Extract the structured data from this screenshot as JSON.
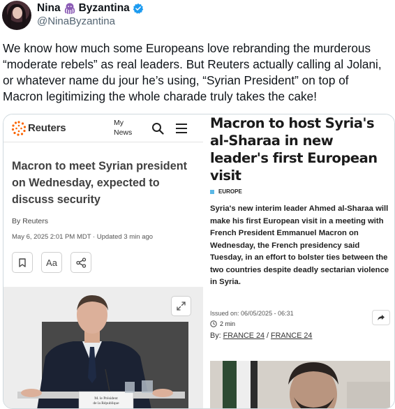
{
  "author": {
    "display_name": "Nina",
    "display_name_suffix": "Byzantina",
    "handle": "@NinaByzantina",
    "badge": "verified-icon",
    "emoji": "octopus-icon"
  },
  "tweet": {
    "text": "We know how much some Europeans love rebranding the murderous “moderate rebels” as real leaders. But Reuters actually calling al Jolani, or whatever name du jour he’s using, “Syrian President” on top of Macron legitimizing the whole charade truly takes the cake!"
  },
  "reuters": {
    "logo_text": "Reuters",
    "mynews_line1": "My",
    "mynews_line2": "News",
    "headline": "Macron to meet Syrian president on Wednesday, expected to discuss security",
    "byline_prefix": "By",
    "byline_source": "Reuters",
    "date": "May 6, 2025 2:01 PM MDT · Updated 3 min ago",
    "font_button_label": "Aa",
    "photo_caption_line1": "M. le Président",
    "photo_caption_line2": "de la République"
  },
  "france24": {
    "headline": "Macron to host Syria's al-Sharaa in new leader's first European visit",
    "section_tag": "EUROPE",
    "lede": "Syria's new interim leader Ahmed al-Sharaa will make his first European visit in a meeting with French President Emmanuel Macron on Wednesday, the French presidency said Tuesday, in an effort to bolster ties between the two countries despite deadly sectarian violence in Syria.",
    "issued_on": "Issued on: 06/05/2025 - 06:31",
    "read_time": "2 min",
    "by_prefix": "By:",
    "author_1": "FRANCE 24",
    "author_separator": "/",
    "author_2": "FRANCE 24"
  },
  "colors": {
    "reuters_orange": "#fa6400",
    "france24_blue": "#5bb8e6",
    "verified_blue": "#1d9bf0",
    "octopus_purple": "#8b5bb5"
  }
}
